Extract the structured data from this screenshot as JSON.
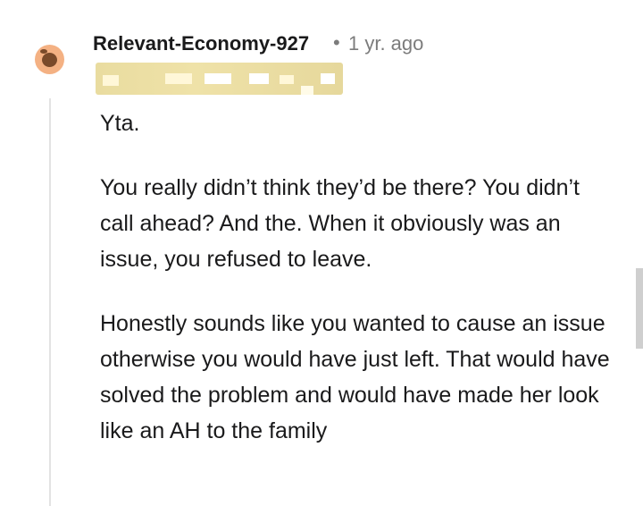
{
  "comment": {
    "author": "Relevant-Economy-927",
    "separator": "•",
    "timestamp": "1 yr. ago",
    "paragraphs": [
      "Yta.",
      "You really didn’t think they’d be there? You didn’t call ahead? And the. When it obviously was an issue, you refused to leave.",
      "Honestly sounds like you wanted to cause an issue otherwise you would have just left. That would have solved the problem and would have made her look like an AH to the family"
    ]
  },
  "colors": {
    "author_text": "#1a1a1b",
    "meta_text": "#7c7c7c",
    "avatar_bg": "#f4b183",
    "flair_bg": "#e9dca0"
  },
  "icons": {
    "avatar": "snoo-avatar-icon"
  }
}
